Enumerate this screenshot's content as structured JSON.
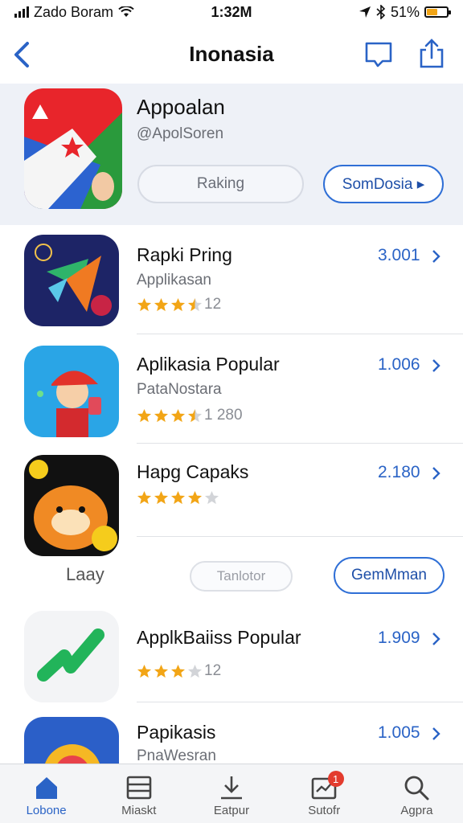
{
  "status_bar": {
    "carrier": "Zado Boram",
    "time": "1:32M",
    "battery": "51%"
  },
  "header": {
    "title": "Inonasia",
    "back_icon": "chevron-left-icon",
    "bookmark_icon": "bookmark-icon",
    "share_icon": "share-icon"
  },
  "featured": {
    "title": "Appoalan",
    "handle": "@ApolSoren",
    "rank_button": "Raking",
    "more_button": "SomDosia ▸"
  },
  "apps": [
    {
      "name": "Rapki Pring",
      "subtitle": "Applikasan",
      "rating": 3.5,
      "reviews": "12",
      "count": "3.001"
    },
    {
      "name": "Aplikasia Popular",
      "subtitle": "PataNostara",
      "rating": 3.5,
      "reviews": "1 280",
      "count": "1.006"
    },
    {
      "name": "Hapg Capaks",
      "subtitle": "",
      "rating": 4,
      "reviews": "",
      "count": "2.180"
    },
    {
      "name": "ApplkBaiiss Popular",
      "subtitle": "",
      "rating": 3,
      "reviews": "12",
      "count": "1.909"
    },
    {
      "name": "Papikasis",
      "subtitle": "PnaWesran",
      "rating": 0,
      "reviews": "",
      "count": "1.005"
    }
  ],
  "mid_actions": {
    "label": "Laay",
    "category_button": "Tanlotor",
    "community_button": "GemMman"
  },
  "tabs": [
    {
      "label": "Lobone",
      "icon": "home-icon",
      "active": true
    },
    {
      "label": "Miaskt",
      "icon": "list-icon",
      "active": false
    },
    {
      "label": "Eatpur",
      "icon": "download-icon",
      "active": false
    },
    {
      "label": "Sutofr",
      "icon": "inbox-icon",
      "active": false,
      "badge": "1"
    },
    {
      "label": "Agpra",
      "icon": "search-icon",
      "active": false
    }
  ],
  "colors": {
    "accent": "#2a63c6",
    "star": "#f2a516",
    "badge": "#e33b2e"
  }
}
